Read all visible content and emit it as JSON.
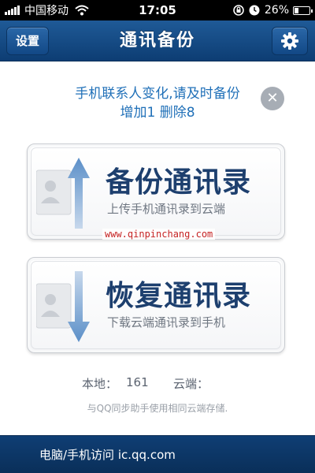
{
  "status_bar": {
    "carrier": "中国移动",
    "time": "17:05",
    "battery_percent": "26%",
    "battery_level": 0.26,
    "icons": [
      "signal-icon",
      "wifi-icon",
      "rotation-lock-icon",
      "clock-icon",
      "battery-icon"
    ]
  },
  "nav": {
    "back_label": "设置",
    "title": "通讯备份",
    "settings_icon": "gear-icon"
  },
  "notice": {
    "line1": "手机联系人变化,请及时备份",
    "line2": "增加1 删除8",
    "dismiss_glyph": "✕"
  },
  "actions": {
    "backup": {
      "title": "备份通讯录",
      "subtitle": "上传手机通讯录到云端",
      "arrow": "up"
    },
    "restore": {
      "title": "恢复通讯录",
      "subtitle": "下载云端通讯录到手机",
      "arrow": "down"
    }
  },
  "watermark": "www.qinpinchang.com",
  "stats": {
    "local_label": "本地：",
    "local_value": "161",
    "cloud_label": "云端：",
    "cloud_value": ""
  },
  "sync_note": "与QQ同步助手使用相同云端存储.",
  "footer": {
    "text": "电脑/手机访问 ic.qq.com"
  },
  "colors": {
    "nav_bg": "#124886",
    "notice_text": "#2070b8",
    "card_title": "#1d3f6e",
    "footer_bg": "#0a2f59",
    "watermark": "#c62424"
  }
}
